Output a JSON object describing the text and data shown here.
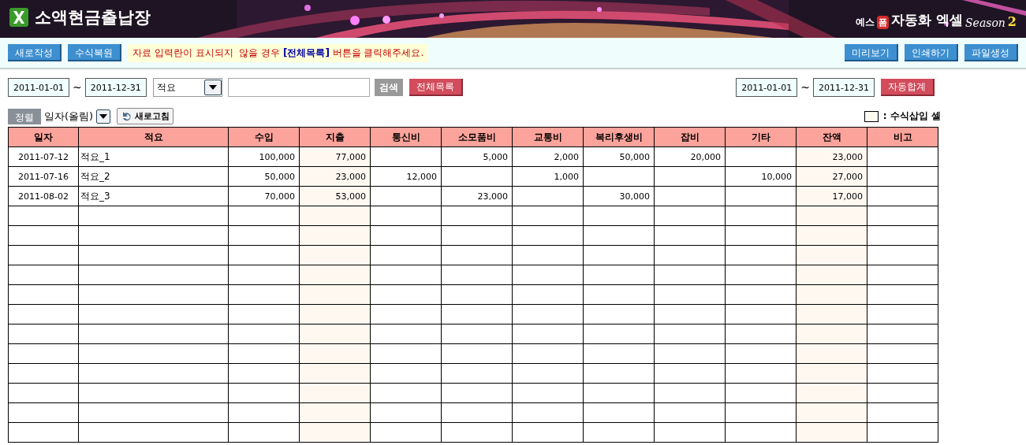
{
  "header": {
    "title": "소액현금출납장",
    "brand": {
      "prefix": "예스",
      "badge": "폼",
      "name": "자동화 엑셀",
      "season": "Season",
      "number": "2"
    }
  },
  "toolbar": {
    "left_buttons": [
      "새로작성",
      "수식복원"
    ],
    "notice": "자료 입력란이 표시되지  않을 경우 **[전체목록]** 버튼을 클릭해주세요.",
    "right_buttons": [
      "미리보기",
      "인쇄하기",
      "파일생성"
    ]
  },
  "filter": {
    "date_from": "2011-01-01",
    "tilde": "~",
    "date_to": "2011-12-31",
    "field": "적요",
    "search_button": "검색",
    "list_button": "전체목록",
    "sum_from": "2011-01-01",
    "sum_tilde": "~",
    "sum_to": "2011-12-31",
    "sum_button": "자동합계"
  },
  "sort": {
    "label": "정렬",
    "value": "일자(올림)",
    "refresh_button": "새로고침"
  },
  "legend": {
    "text": ": 수식삽입 셀"
  },
  "table": {
    "columns": [
      {
        "label": "일자",
        "formula": false
      },
      {
        "label": "적요",
        "formula": false
      },
      {
        "label": "수입",
        "formula": false
      },
      {
        "label": "지출",
        "formula": true
      },
      {
        "label": "통신비",
        "formula": false
      },
      {
        "label": "소모품비",
        "formula": false
      },
      {
        "label": "교통비",
        "formula": false
      },
      {
        "label": "복리후생비",
        "formula": false
      },
      {
        "label": "잡비",
        "formula": false
      },
      {
        "label": "기타",
        "formula": false
      },
      {
        "label": "잔액",
        "formula": true
      },
      {
        "label": "비고",
        "formula": false
      }
    ],
    "rows": [
      [
        "2011-07-12",
        "적요_1",
        "100,000",
        "77,000",
        null,
        "5,000",
        "2,000",
        "50,000",
        "20,000",
        null,
        "23,000",
        null
      ],
      [
        "2011-07-16",
        "적요_2",
        "50,000",
        "23,000",
        "12,000",
        null,
        "1,000",
        null,
        null,
        "10,000",
        "27,000",
        null
      ],
      [
        "2011-08-02",
        "적요_3",
        "70,000",
        "53,000",
        null,
        "23,000",
        null,
        "30,000",
        null,
        null,
        "17,000",
        null
      ]
    ]
  }
}
